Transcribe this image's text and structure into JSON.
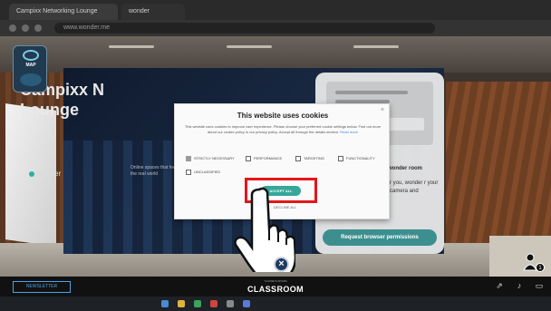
{
  "browser": {
    "tabs": [
      "Campixx Networking Lounge",
      "wonder"
    ],
    "url": "www.wonder.me"
  },
  "room": {
    "map_label": "MAP",
    "panel_title": "Campixx N\nLounge",
    "wonder_logo": "wonder",
    "wonder_tagline": "Online spaces that feel just like the real world"
  },
  "permissions_card": {
    "title": "wonder room",
    "text": "r you, wonder r your camera and",
    "request_button": "Request browser permissions"
  },
  "cookie_dialog": {
    "close": "×",
    "title": "This website uses cookies",
    "text": "This website uses cookies to improve user experience. Please choose your preferred cookie settings below. Find out more about our cookie policy in our privacy policy. Accept all through the details section.",
    "link": "Read more",
    "options": [
      {
        "label": "STRICTLY NECESSARY",
        "checked": true
      },
      {
        "label": "PERFORMANCE",
        "checked": false
      },
      {
        "label": "TARGETING",
        "checked": false
      },
      {
        "label": "FUNCTIONALITY",
        "checked": false
      },
      {
        "label": "UNCLASSIFIED",
        "checked": false
      }
    ],
    "accept_button": "ACCEPT ALL",
    "decline": "DECLINE ALL"
  },
  "controls": {
    "close_button": "×",
    "people_count": "1"
  },
  "bottom_bar": {
    "newsletter_button": "NEWSLETTER",
    "room_subtitle": "YOU'RE IN ROOM",
    "room_name": "CLASSROOM",
    "share_icon": "share-icon",
    "sound_icon": "speaker-icon",
    "screen_icon": "screen-icon"
  },
  "colors": {
    "accent_teal": "#35a89a",
    "highlight_red": "#e3161b",
    "newsletter_blue": "#4aa3e8"
  }
}
